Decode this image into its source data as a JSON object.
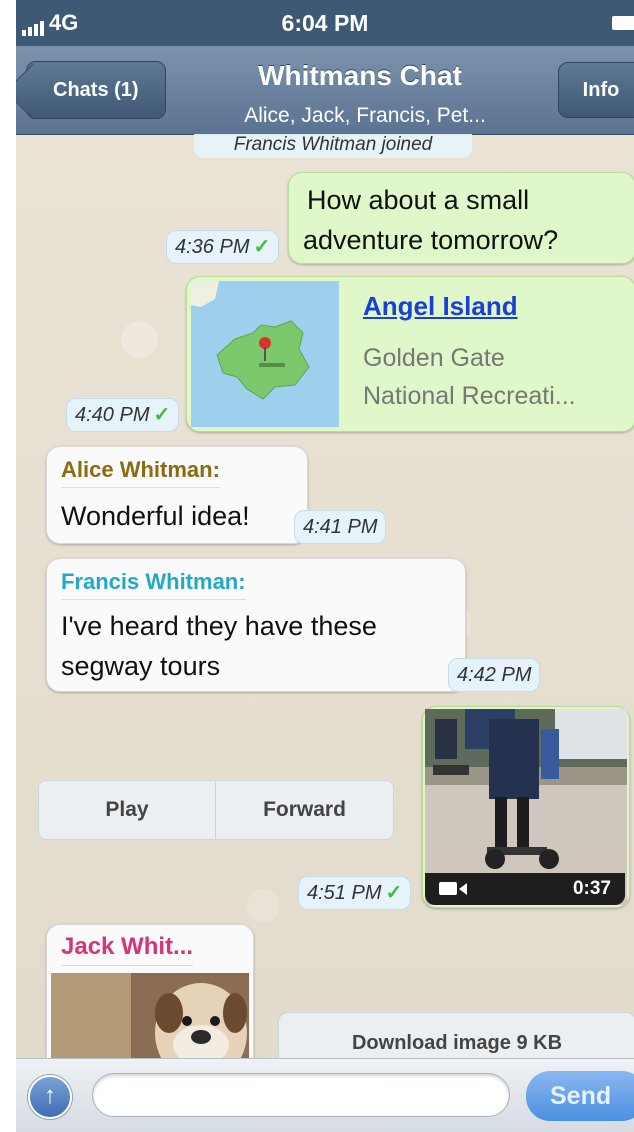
{
  "status_bar": {
    "carrier": "4G",
    "time": "6:04 PM"
  },
  "nav": {
    "back_label": "Chats (1)",
    "title": "Whitmans Chat",
    "subtitle": "Alice, Jack, Francis, Pet...",
    "info_label": "Info"
  },
  "messages": {
    "system_notice": "Francis Whitman joined",
    "m1": {
      "text_line1": "How about a small",
      "text_line2": "adventure tomorrow?",
      "time": "4:36 PM",
      "status": "✓"
    },
    "m2": {
      "place": "Angel Island",
      "address_line1": "Golden Gate",
      "address_line2": "National Recreati...",
      "time": "4:40 PM",
      "status": "✓"
    },
    "m3": {
      "sender": "Alice Whitman:",
      "text": "Wonderful idea!",
      "time": "4:41 PM"
    },
    "m4": {
      "sender": "Francis Whitman:",
      "text_line1": "I've heard they have these",
      "text_line2": "segway tours",
      "time": "4:42 PM"
    },
    "m5": {
      "play_label": "Play",
      "forward_label": "Forward",
      "duration": "0:37",
      "time": "4:51 PM",
      "status": "✓"
    },
    "m6": {
      "sender": "Jack Whit...",
      "download_label": "Download image 9 KB"
    }
  },
  "composer": {
    "placeholder": "",
    "send_label": "Send"
  },
  "colors": {
    "nav_bar": "#5b7392",
    "outgoing_bubble": "#dff7c9",
    "incoming_bubble": "#fafafa",
    "alice_name": "#8a6b10",
    "francis_name": "#22a8c8",
    "jack_name": "#d8337a",
    "link": "#1a3fd6",
    "delivered_check": "#3cbe3c"
  }
}
